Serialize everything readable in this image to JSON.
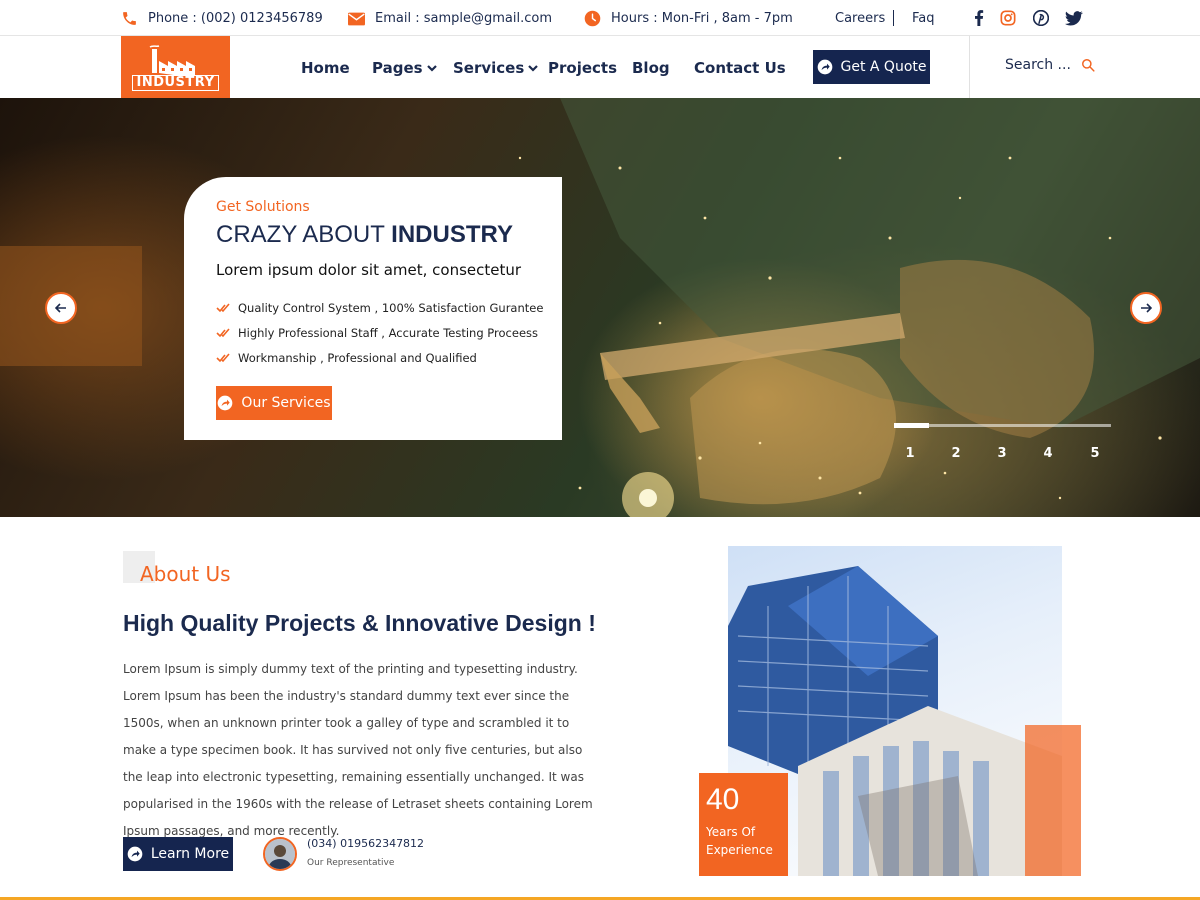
{
  "topbar": {
    "phone": "Phone : (002) 0123456789",
    "email": "Email : sample@gmail.com",
    "hours": "Hours : Mon-Fri , 8am - 7pm",
    "careers": "Careers",
    "faq": "Faq",
    "social_icons": [
      "facebook-icon",
      "instagram-icon",
      "pinterest-icon",
      "twitter-icon"
    ]
  },
  "header": {
    "logo_text": "INDUSTRY",
    "nav": {
      "home": "Home",
      "pages": "Pages",
      "services": "Services",
      "projects": "Projects",
      "blog": "Blog",
      "contact": "Contact Us"
    },
    "quote_button": "Get A Quote",
    "search_text": "Search ..."
  },
  "hero": {
    "subtitle": "Get Solutions",
    "title_light": "CRAZY ABOUT ",
    "title_bold": "INDUSTRY",
    "lead": "Lorem ipsum dolor sit amet, consectetur",
    "checks": [
      "Quality Control System , 100% Satisfaction Gurantee",
      "Highly Professional Staff , Accurate Testing Proceess",
      "Workmanship , Professional and Qualified"
    ],
    "button": "Our Services",
    "slides": [
      "1",
      "2",
      "3",
      "4",
      "5"
    ],
    "active_slide": 1,
    "progress_fraction": 0.16
  },
  "about": {
    "label": "About Us",
    "title": "High Quality Projects & Innovative Design !",
    "text": "Lorem Ipsum is simply dummy text of the printing and typesetting industry. Lorem Ipsum has been the industry's standard dummy text ever since the 1500s, when an unknown printer took a galley of type and scrambled it to make a type specimen book. It has survived not only five centuries, but also the leap into electronic typesetting, remaining essentially unchanged. It was popularised in the 1960s with the release of Letraset sheets containing Lorem Ipsum passages, and more recently.",
    "button": "Learn More",
    "rep_phone": "(034) 019562347812",
    "rep_label": "Our Representative",
    "experience_number": "40",
    "experience_text_1": "Years Of",
    "experience_text_2": "Experience"
  },
  "colors": {
    "accent": "#f26522",
    "navy": "#15254f",
    "bottom_rule": "#f5a623"
  }
}
